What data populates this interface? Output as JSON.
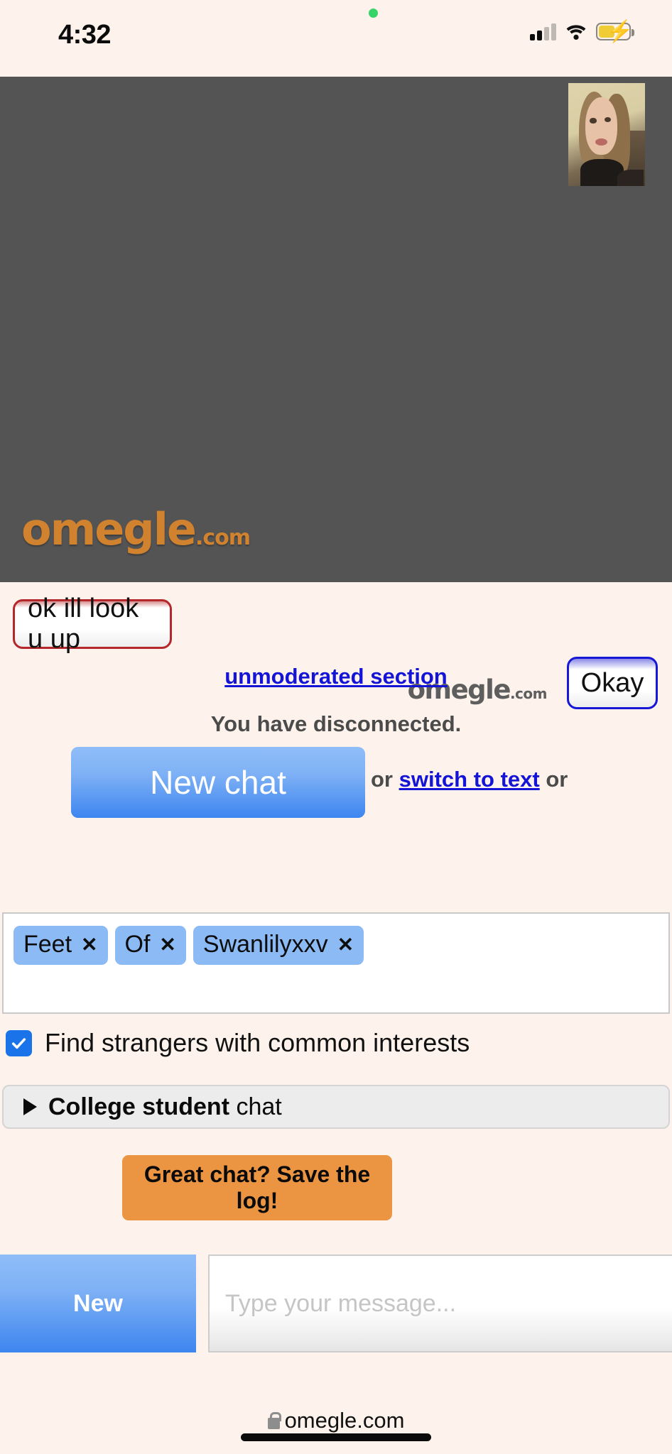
{
  "status_bar": {
    "time": "4:32",
    "recording_dot": "recording-indicator",
    "cellular": "signal-bars-icon",
    "wifi": "wifi-icon",
    "battery": "battery-charging-icon"
  },
  "video": {
    "logo_text": "omegle",
    "logo_tld": ".com",
    "self_cam": "self-camera-preview"
  },
  "chat": {
    "stranger_message": "ok ill look u up",
    "your_message": "Okay",
    "watermark_text": "omegle",
    "watermark_tld": ".com",
    "status_message": "You have disconnected."
  },
  "actions": {
    "new_chat_label": "New chat",
    "or_prefix": "or ",
    "switch_to_text_label": "switch to text",
    "or_suffix": " or",
    "unmoderated_label": "unmoderated section",
    "save_log_label": "Great chat? Save the log!"
  },
  "interests": {
    "tags": [
      {
        "label": "Feet",
        "remove": "✕"
      },
      {
        "label": "Of",
        "remove": "✕"
      },
      {
        "label": "Swanlilyxxv",
        "remove": "✕"
      }
    ],
    "common_interests_label": "Find strangers with common interests",
    "common_interests_checked": true
  },
  "college": {
    "bold_label": "College student",
    "rest_label": " chat"
  },
  "composer": {
    "new_label": "New",
    "input_value": "",
    "input_placeholder": "Type your message..."
  },
  "footer": {
    "url": "omegle.com",
    "lock": "lock-icon"
  },
  "colors": {
    "page_background": "#fdf3ec",
    "video_background": "#545454",
    "logo_orange": "#d1822f",
    "stranger_border": "#b4272a",
    "you_border": "#1717d8",
    "primary_blue": "#3d85f0",
    "tag_blue": "#8cbaf5",
    "save_orange": "#eb9542",
    "link_blue": "#1414d6",
    "checkbox_blue": "#1a73e8"
  }
}
